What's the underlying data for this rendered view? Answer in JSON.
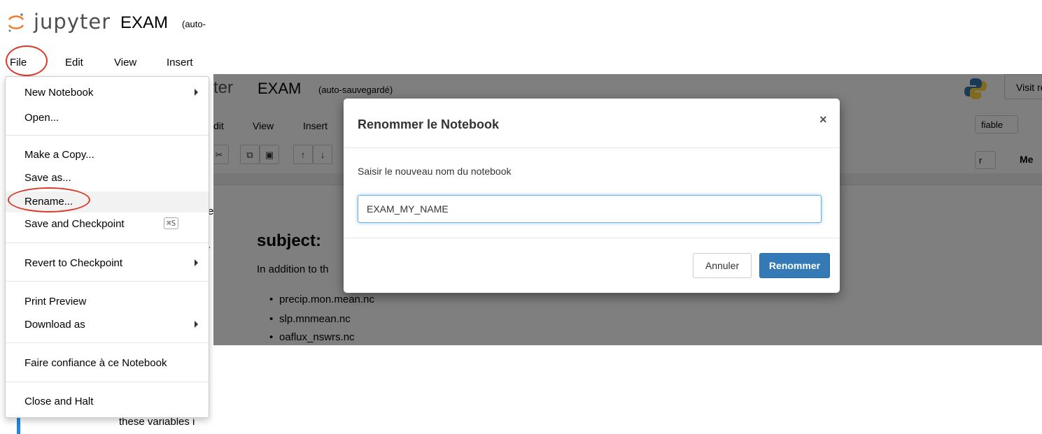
{
  "left": {
    "brand": "jupyter",
    "notebook_title": "EXAM",
    "autosave_fragment": "(auto-",
    "menu": {
      "file": "File",
      "edit": "Edit",
      "view": "View",
      "insert": "Insert"
    },
    "file_menu": {
      "new_notebook": "New Notebook",
      "open": "Open...",
      "make_copy": "Make a Copy...",
      "save_as": "Save as...",
      "rename": "Rename...",
      "save_checkpoint": "Save and Checkpoint",
      "save_checkpoint_shortcut": "⌘S",
      "revert": "Revert to Checkpoint",
      "print_preview": "Print Preview",
      "download_as": "Download as",
      "trust": "Faire confiance à ce Notebook",
      "close_halt": "Close and Halt"
    },
    "bg_text": "these variables i"
  },
  "right": {
    "title_fragment": "ter",
    "notebook_title": "EXAM",
    "autosave": "(auto-sauvegardé)",
    "visit_fragment": "Visit re",
    "menu": {
      "edit": "dit",
      "view": "View",
      "insert": "Insert"
    },
    "trust_fragment": "fiable",
    "kernel_fragment": "r",
    "me_fragment": "Me",
    "subject_heading": "subject:",
    "intro": "In addition to th",
    "files": [
      "precip.mon.mean.nc",
      "slp.mnmean.nc",
      "oaflux_nswrs.nc"
    ],
    "dialog": {
      "title": "Renommer le Notebook",
      "close": "×",
      "label": "Saisir le nouveau nom du notebook",
      "input_value": "EXAM_MY_NAME",
      "cancel": "Annuler",
      "confirm": "Renommer"
    }
  },
  "colors": {
    "highlight_circle": "#d93a2b",
    "primary_button": "#337ab7",
    "input_focus": "#66afe9"
  }
}
